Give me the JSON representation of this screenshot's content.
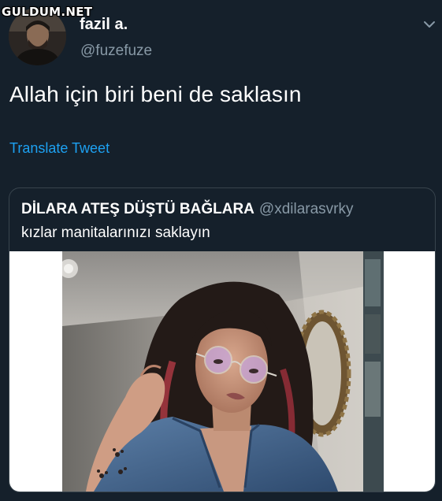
{
  "watermark": "GULDUM.NET",
  "author": {
    "display_name": "fazil a.",
    "handle": "@fuzefuze"
  },
  "tweet": {
    "text": "Allah için biri beni de saklasın",
    "translate_label": "Translate Tweet"
  },
  "quoted_tweet": {
    "display_name": "DİLARA ATEŞ DÜŞTÜ BAĞLARA",
    "handle": "@xdilarasvrky",
    "text": "kızlar manitalarınızı saklayın"
  },
  "icons": {
    "more_menu": "chevron-down-icon",
    "avatar": "user-avatar-photo",
    "media": "selfie-photo"
  },
  "colors": {
    "background": "#15202b",
    "text_primary": "#ffffff",
    "text_secondary": "#8899a6",
    "link": "#1da1f2",
    "border": "#38444d"
  }
}
